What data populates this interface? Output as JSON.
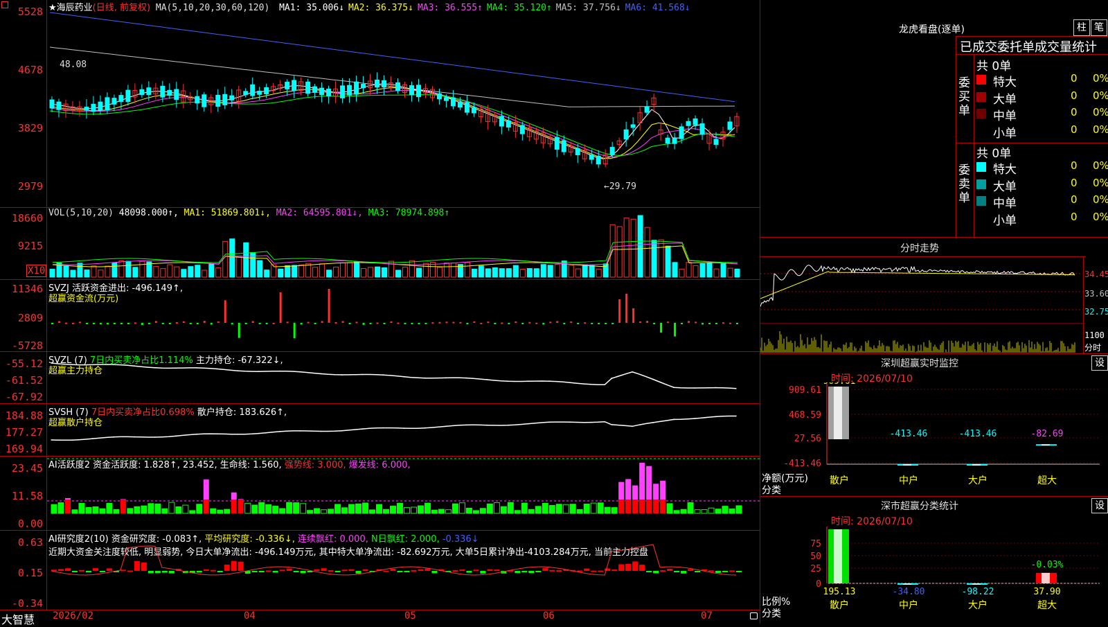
{
  "stock": {
    "name": "★海辰药业",
    "mode": "(日线, 前复权)",
    "ma_label": "MA(5,10,20,30,60,120)",
    "ma": [
      {
        "label": "MA1: 35.006↓",
        "color": "#ffffff"
      },
      {
        "label": "MA2: 36.375↓",
        "color": "#ffff00"
      },
      {
        "label": "MA3: 36.555↑",
        "color": "#ff40ff"
      },
      {
        "label": "MA4: 35.120↑",
        "color": "#00ff00"
      },
      {
        "label": "MA5: 37.756↓",
        "color": "#c0c0c0"
      },
      {
        "label": "MA6: 41.568↓",
        "color": "#4060ff"
      }
    ],
    "price_axis": [
      "5528",
      "4678",
      "3829",
      "2979"
    ],
    "high_note": "48.08",
    "low_note": "←29.79"
  },
  "vol": {
    "title": "VOL(5,10,20)",
    "value": "48098.000↑,",
    "ma1": "MA1: 51869.801↓,",
    "ma2": "MA2: 64595.801↓,",
    "ma3": "MA3: 78974.898↑",
    "axis": [
      "18660",
      "9215"
    ],
    "unit": "X10"
  },
  "svzj": {
    "title": "SVZJ  活跃资金进出: -496.149↑,",
    "subtitle": "超赢资金流(万元)",
    "axis": [
      "11346",
      "2809",
      "-5728"
    ]
  },
  "svzl": {
    "title_a": "SVZL (7)",
    "title_b": "7日内买卖净占比1.114%",
    "title_c": "主力持仓: -67.322↓,",
    "subtitle": "超赢主力持仓",
    "axis": [
      "-55.12",
      "-61.52",
      "-67.92"
    ]
  },
  "svsh": {
    "title_a": "SVSH (7)",
    "title_b": "7日内买卖净占比0.698%",
    "title_c": "散户持仓: 183.626↑,",
    "subtitle": "超赢散户持仓",
    "axis": [
      "184.88",
      "177.27",
      "169.94"
    ]
  },
  "ai_active": {
    "title": "AI活跃度2 资金活跃度: 1.828↑, 23.452, 生命线: 1.560, ",
    "strong": "强势线: 3.000,",
    "burst": "爆发线: 6.000,",
    "axis": [
      "23.45",
      "11.58",
      "0.00"
    ]
  },
  "ai_research": {
    "title": "AI研究度2(10) 资金研究度: -0.083↑,",
    "avg": "平均研究度: -0.336↓,",
    "red": "连续飘红: 0.000,",
    "nred": "N日飘红: 2.000,",
    "tail": "-0.336↓",
    "comment": "近期大资金关注度较低, 明显弱势, 今日大单净流出: -496.149万元, 其中特大单净流出: -82.692万元, 大单5日累计净出-4103.284万元, 当前主力控盘",
    "axis": [
      "0.63",
      "0.15",
      "-0.34"
    ]
  },
  "time_axis": [
    "2026/02",
    "04",
    "05",
    "06",
    "07"
  ],
  "brand": "大智慧",
  "right": {
    "lhb_title": "龙虎看盘(逐单)",
    "btn_zhu": "柱",
    "btn_ce": "笔",
    "tabs_title": "已成交委托单成交量统计",
    "buy": {
      "side_label": "委买单",
      "total": "共 0单",
      "rows": [
        {
          "label": "特大",
          "value": "0",
          "pct": "0%",
          "color": "#ff0000"
        },
        {
          "label": "大单",
          "value": "0",
          "pct": "0%",
          "color": "#a00000"
        },
        {
          "label": "中单",
          "value": "0",
          "pct": "0%",
          "color": "#700000"
        },
        {
          "label": "小单",
          "value": "0",
          "pct": "0%",
          "color": "#000000"
        }
      ]
    },
    "sell": {
      "side_label": "委卖单",
      "total": "共 0单",
      "rows": [
        {
          "label": "特大",
          "value": "0",
          "pct": "0%",
          "color": "#00ffff"
        },
        {
          "label": "大单",
          "value": "0",
          "pct": "0%",
          "color": "#00a0a0"
        },
        {
          "label": "中单",
          "value": "0",
          "pct": "0%",
          "color": "#008080"
        },
        {
          "label": "小单",
          "value": "0",
          "pct": "0%",
          "color": "#000000"
        }
      ]
    },
    "intraday": {
      "title": "分时走势",
      "axis": [
        "34.45",
        "33.60",
        "32.75"
      ],
      "vol_label": "1100",
      "vol_unit": "分时"
    },
    "monitor": {
      "title": "深圳超赢实时监控",
      "setting": "设",
      "time": "时间: 2026/07/10",
      "axis": [
        "909.61",
        "468.59",
        "27.56",
        "-413.46"
      ],
      "unit_label": "净额(万元)",
      "cat_label": "分类",
      "bars": [
        {
          "cat": "散户",
          "value": 909.61,
          "label": "909.61"
        },
        {
          "cat": "中户",
          "value": -413.46,
          "label": "-413.46"
        },
        {
          "cat": "大户",
          "value": -413.46,
          "label": "-413.46"
        },
        {
          "cat": "超大",
          "value": -82.69,
          "label": "-82.69"
        }
      ]
    },
    "classify": {
      "title": "深市超赢分类统计",
      "setting": "设",
      "time": "时间: 2026/07/10",
      "axis": [
        "75",
        "50",
        "25",
        "0"
      ],
      "unit_label": "比例%",
      "cat_label": "分类",
      "bars": [
        {
          "cat": "散户",
          "value": 195.13,
          "label": "195.13"
        },
        {
          "cat": "中户",
          "value": -34.8,
          "label": "-34.80"
        },
        {
          "cat": "大户",
          "value": -98.22,
          "label": "-98.22"
        },
        {
          "cat": "超大",
          "value": 37.9,
          "label": "37.90",
          "note": "-0.03%"
        }
      ]
    }
  },
  "chart_data": [
    {
      "type": "candlestick",
      "title": "海辰药业 日线 前复权",
      "ylim": [
        2800,
        5600
      ],
      "x": [
        "2026/02",
        "04",
        "05",
        "06",
        "07"
      ],
      "series": [
        {
          "name": "MA6",
          "values": []
        }
      ],
      "notes": {
        "high": 48.08,
        "low": 29.79
      }
    },
    {
      "type": "bar",
      "title": "深圳超赢实时监控",
      "categories": [
        "散户",
        "中户",
        "大户",
        "超大"
      ],
      "values": [
        909.61,
        -413.46,
        -413.46,
        -82.69
      ],
      "ylabel": "净额(万元)",
      "ylim": [
        -413.46,
        909.61
      ]
    },
    {
      "type": "bar",
      "title": "深市超赢分类统计",
      "categories": [
        "散户",
        "中户",
        "大户",
        "超大"
      ],
      "values": [
        195.13,
        -34.8,
        -98.22,
        37.9
      ],
      "ylabel": "比例%",
      "ylim": [
        0,
        75
      ]
    }
  ]
}
